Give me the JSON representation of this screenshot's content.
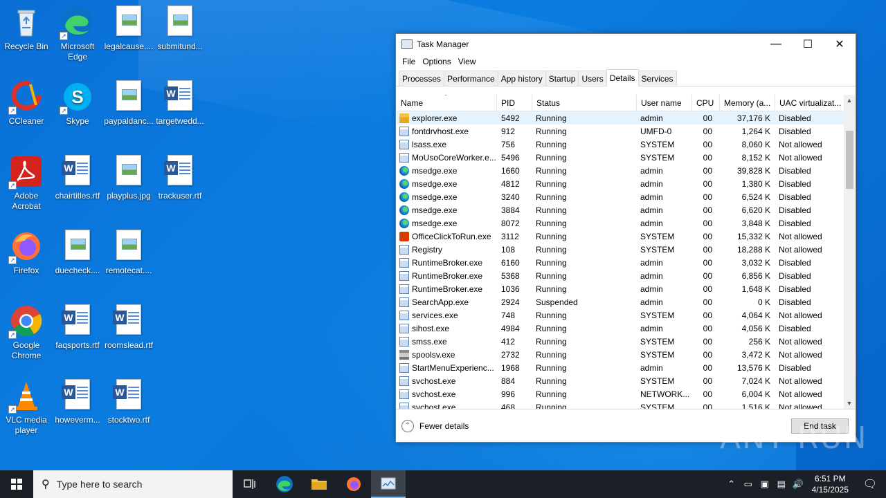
{
  "desktop": {
    "icons": [
      {
        "label": "Recycle Bin",
        "kind": "recycle"
      },
      {
        "label": "Microsoft Edge",
        "kind": "edge"
      },
      {
        "label": "legalcause....",
        "kind": "image"
      },
      {
        "label": "submitund...",
        "kind": "image"
      },
      {
        "label": "CCleaner",
        "kind": "ccleaner"
      },
      {
        "label": "Skype",
        "kind": "skype"
      },
      {
        "label": "paypaldanc...",
        "kind": "image"
      },
      {
        "label": "targetwedd...",
        "kind": "word"
      },
      {
        "label": "Adobe Acrobat",
        "kind": "acrobat"
      },
      {
        "label": "chairtitles.rtf",
        "kind": "word"
      },
      {
        "label": "playplus.jpg",
        "kind": "image"
      },
      {
        "label": "trackuser.rtf",
        "kind": "word"
      },
      {
        "label": "Firefox",
        "kind": "firefox"
      },
      {
        "label": "duecheck....",
        "kind": "image"
      },
      {
        "label": "remotecat....",
        "kind": "image"
      },
      {
        "label": "Google Chrome",
        "kind": "chrome"
      },
      {
        "label": "faqsports.rtf",
        "kind": "word"
      },
      {
        "label": "roomslead.rtf",
        "kind": "word"
      },
      {
        "label": "VLC media player",
        "kind": "vlc"
      },
      {
        "label": "howeverm...",
        "kind": "word"
      },
      {
        "label": "stocktwo.rtf",
        "kind": "word"
      }
    ]
  },
  "taskmanager": {
    "title": "Task Manager",
    "menu": [
      "File",
      "Options",
      "View"
    ],
    "tabs": [
      "Processes",
      "Performance",
      "App history",
      "Startup",
      "Users",
      "Details",
      "Services"
    ],
    "active_tab": "Details",
    "columns": [
      "Name",
      "PID",
      "Status",
      "User name",
      "CPU",
      "Memory (a...",
      "UAC virtualizat..."
    ],
    "rows": [
      {
        "name": "explorer.exe",
        "pid": "5492",
        "status": "Running",
        "user": "admin",
        "cpu": "00",
        "mem": "37,176 K",
        "uac": "Disabled",
        "icon": "folder"
      },
      {
        "name": "fontdrvhost.exe",
        "pid": "912",
        "status": "Running",
        "user": "UMFD-0",
        "cpu": "00",
        "mem": "1,264 K",
        "uac": "Disabled",
        "icon": "app"
      },
      {
        "name": "lsass.exe",
        "pid": "756",
        "status": "Running",
        "user": "SYSTEM",
        "cpu": "00",
        "mem": "8,060 K",
        "uac": "Not allowed",
        "icon": "app"
      },
      {
        "name": "MoUsoCoreWorker.e...",
        "pid": "5496",
        "status": "Running",
        "user": "SYSTEM",
        "cpu": "00",
        "mem": "8,152 K",
        "uac": "Not allowed",
        "icon": "app"
      },
      {
        "name": "msedge.exe",
        "pid": "1660",
        "status": "Running",
        "user": "admin",
        "cpu": "00",
        "mem": "39,828 K",
        "uac": "Disabled",
        "icon": "edge"
      },
      {
        "name": "msedge.exe",
        "pid": "4812",
        "status": "Running",
        "user": "admin",
        "cpu": "00",
        "mem": "1,380 K",
        "uac": "Disabled",
        "icon": "edge"
      },
      {
        "name": "msedge.exe",
        "pid": "3240",
        "status": "Running",
        "user": "admin",
        "cpu": "00",
        "mem": "6,524 K",
        "uac": "Disabled",
        "icon": "edge"
      },
      {
        "name": "msedge.exe",
        "pid": "3884",
        "status": "Running",
        "user": "admin",
        "cpu": "00",
        "mem": "6,620 K",
        "uac": "Disabled",
        "icon": "edge"
      },
      {
        "name": "msedge.exe",
        "pid": "8072",
        "status": "Running",
        "user": "admin",
        "cpu": "00",
        "mem": "3,848 K",
        "uac": "Disabled",
        "icon": "edge"
      },
      {
        "name": "OfficeClickToRun.exe",
        "pid": "3112",
        "status": "Running",
        "user": "SYSTEM",
        "cpu": "00",
        "mem": "15,332 K",
        "uac": "Not allowed",
        "icon": "office"
      },
      {
        "name": "Registry",
        "pid": "108",
        "status": "Running",
        "user": "SYSTEM",
        "cpu": "00",
        "mem": "18,288 K",
        "uac": "Not allowed",
        "icon": "app"
      },
      {
        "name": "RuntimeBroker.exe",
        "pid": "6160",
        "status": "Running",
        "user": "admin",
        "cpu": "00",
        "mem": "3,032 K",
        "uac": "Disabled",
        "icon": "app"
      },
      {
        "name": "RuntimeBroker.exe",
        "pid": "5368",
        "status": "Running",
        "user": "admin",
        "cpu": "00",
        "mem": "6,856 K",
        "uac": "Disabled",
        "icon": "app"
      },
      {
        "name": "RuntimeBroker.exe",
        "pid": "1036",
        "status": "Running",
        "user": "admin",
        "cpu": "00",
        "mem": "1,648 K",
        "uac": "Disabled",
        "icon": "app"
      },
      {
        "name": "SearchApp.exe",
        "pid": "2924",
        "status": "Suspended",
        "user": "admin",
        "cpu": "00",
        "mem": "0 K",
        "uac": "Disabled",
        "icon": "app"
      },
      {
        "name": "services.exe",
        "pid": "748",
        "status": "Running",
        "user": "SYSTEM",
        "cpu": "00",
        "mem": "4,064 K",
        "uac": "Not allowed",
        "icon": "app"
      },
      {
        "name": "sihost.exe",
        "pid": "4984",
        "status": "Running",
        "user": "admin",
        "cpu": "00",
        "mem": "4,056 K",
        "uac": "Disabled",
        "icon": "app"
      },
      {
        "name": "smss.exe",
        "pid": "412",
        "status": "Running",
        "user": "SYSTEM",
        "cpu": "00",
        "mem": "256 K",
        "uac": "Not allowed",
        "icon": "app"
      },
      {
        "name": "spoolsv.exe",
        "pid": "2732",
        "status": "Running",
        "user": "SYSTEM",
        "cpu": "00",
        "mem": "3,472 K",
        "uac": "Not allowed",
        "icon": "printer"
      },
      {
        "name": "StartMenuExperienc...",
        "pid": "1968",
        "status": "Running",
        "user": "admin",
        "cpu": "00",
        "mem": "13,576 K",
        "uac": "Disabled",
        "icon": "app"
      },
      {
        "name": "svchost.exe",
        "pid": "884",
        "status": "Running",
        "user": "SYSTEM",
        "cpu": "00",
        "mem": "7,024 K",
        "uac": "Not allowed",
        "icon": "app"
      },
      {
        "name": "svchost.exe",
        "pid": "996",
        "status": "Running",
        "user": "NETWORK...",
        "cpu": "00",
        "mem": "6,004 K",
        "uac": "Not allowed",
        "icon": "app"
      },
      {
        "name": "svchost.exe",
        "pid": "468",
        "status": "Running",
        "user": "SYSTEM",
        "cpu": "00",
        "mem": "1,516 K",
        "uac": "Not allowed",
        "icon": "app"
      }
    ],
    "fewer_details": "Fewer details",
    "end_task": "End task"
  },
  "taskbar": {
    "search_placeholder": "Type here to search",
    "time": "6:51 PM",
    "date": "4/15/2025"
  },
  "watermark": "ANY RUN",
  "colors": {
    "desktop_blue": "#0a74d8",
    "taskbar": "#1b2027",
    "selected_row": "#e5f3ff"
  }
}
